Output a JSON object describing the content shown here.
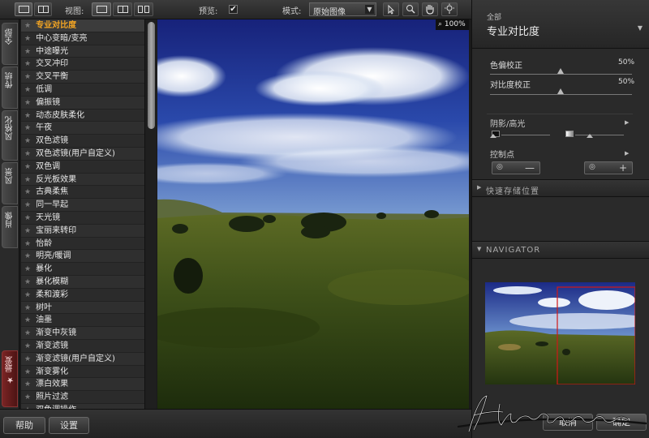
{
  "toolbar": {
    "view_label": "视图:",
    "preview_label": "预览:",
    "preview_checked": "✔",
    "mode_label": "模式:",
    "mode_value": "原始图像"
  },
  "side_tabs": {
    "all": "全部",
    "traditional": "传统",
    "stylized": "风格化",
    "landscape": "风景",
    "portrait": "肖像",
    "favorites": "最爱"
  },
  "filters": [
    "专业对比度",
    "中心变暗/变亮",
    "中途曝光",
    "交叉冲印",
    "交叉平衡",
    "低调",
    "偏振镜",
    "动态皮肤柔化",
    "午夜",
    "双色滤镜",
    "双色滤镜(用户自定义)",
    "双色调",
    "反光板效果",
    "古典柔焦",
    "同一早起",
    "天光镜",
    "宝丽来转印",
    "怡龄",
    "明亮/暖调",
    "暴化",
    "暴化模糊",
    "柔和渡彩",
    "树叶",
    "油墨",
    "渐变中灰镜",
    "渐变滤镜",
    "渐变滤镜(用户自定义)",
    "渐变雾化",
    "漂白效果",
    "照片过滤",
    "双色调操作"
  ],
  "zoom_level": "100%",
  "panel": {
    "category": "全部",
    "title": "专业对比度",
    "params": [
      {
        "label": "色偏校正",
        "value": "50%"
      },
      {
        "label": "对比度校正",
        "value": "50%"
      }
    ],
    "shadows_highlights": "阴影/高光",
    "control_points": "控制点",
    "quick_save": "快速存储位置",
    "navigator": "NAVIGATOR"
  },
  "bottom": {
    "help": "帮助",
    "settings": "设置",
    "cancel": "取消",
    "ok": "确定"
  },
  "watermark": "Huoshanwuo"
}
